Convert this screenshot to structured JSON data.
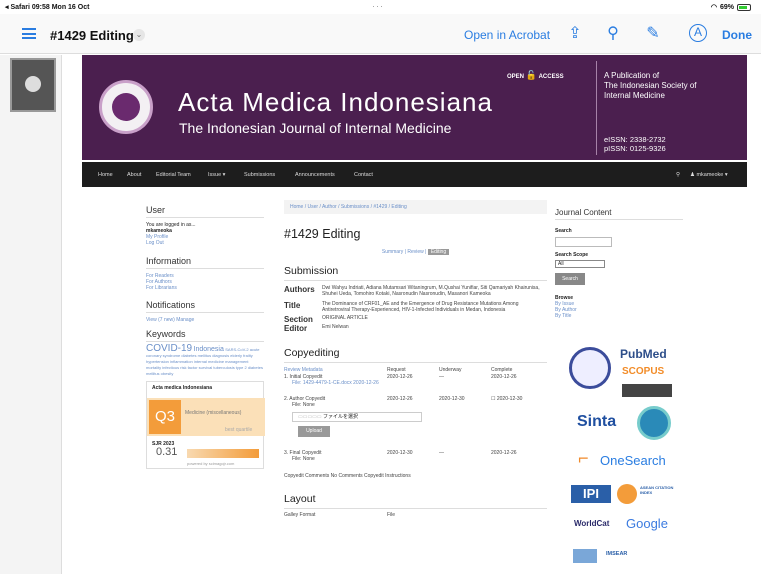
{
  "status": {
    "left": "◂ Safari  09:58  Mon 16 Oct",
    "center": "···",
    "battery": "69%"
  },
  "toolbar": {
    "title": "#1429 Editing",
    "open_acrobat": "Open in Acrobat",
    "done": "Done"
  },
  "banner": {
    "open_access": "OPEN",
    "access": "ACCESS",
    "title": "Acta Medica Indonesiana",
    "subtitle": "The Indonesian Journal of Internal Medicine",
    "pub1": "A Publication of",
    "pub2": "The Indonesian Society of",
    "pub3": "Internal Medicine",
    "eissn": "eISSN: 2338-2732",
    "pissn": "pISSN: 0125-9326"
  },
  "nav": {
    "home": "Home",
    "about": "About",
    "editorial": "Editorial Team",
    "issue": "Issue ▾",
    "submissions": "Submissions",
    "announcements": "Announcements",
    "contact": "Contact",
    "user": "♟ mkameoke ▾"
  },
  "left": {
    "user_h": "User",
    "logged": "You are logged in as...",
    "uname": "mkameoka",
    "profile": "My Profile",
    "logout": "Log Out",
    "info_h": "Information",
    "readers": "For Readers",
    "authors": "For Authors",
    "librarians": "For Librarians",
    "notif_h": "Notifications",
    "view": "View (7 new)",
    "manage": "Manage",
    "kw_h": "Keywords",
    "kw_big": "COVID-19",
    "kw_med": "Indonesia",
    "kw_small": "SARS-CoV-2 acute coronary syndrome diabetes mellitus diagnosis elderly frailty hypertension inflammation internal medicine management mortality infectious risk factor survival tuberculosis type 2 diabetes mellitus obesity",
    "sj_title": "Acta medica Indonesiana",
    "sj_q": "Q3",
    "sj_cat": "Medicine (miscellaneous)",
    "sj_best": "best quartile",
    "sj_label": "SJR 2023",
    "sj_value": "0.31",
    "sj_powered": "powered by scimagojr.com"
  },
  "main": {
    "crumb": "Home  /  User  /  Author  /  Submissions  /  #1429  /  Editing",
    "title": "#1429 Editing",
    "tabs": {
      "summary": "Summary",
      "review": "Review",
      "editing": "Editing"
    },
    "submission_h": "Submission",
    "authors_k": "Authors",
    "authors_v": "Dwi Wahyu Indriati, Adiana Mutamsari Witaningrum, M.Qushai Yunifiar, Siti Qamariyah Khairunisa, Shuhei Ueda, Tomohiro Kotaki, Nasronudin Nasronudin, Masanori Kameoka",
    "title_k": "Title",
    "title_v": "The Dominance of CRF01_AE and the Emergence of Drug Resistance Mutations Among Antiretroviral Therapy-Experienced, HIV-1-Infected Individuals in Medan, Indonesia",
    "section_k": "Section",
    "section_v": "ORIGINAL ARTICLE",
    "editor_k": "Editor",
    "editor_v": "Emi Nelwan",
    "copy_h": "Copyediting",
    "cols": {
      "meta": "Review Metadata",
      "req": "Request",
      "und": "Underway",
      "comp": "Complete"
    },
    "r1": {
      "name": "1.  Initial Copyedit",
      "file": "File: 1429-4479-1-CE.docx  2020-12-26",
      "req": "2020-12-26",
      "und": "—",
      "comp": "2020-12-26"
    },
    "r2": {
      "name": "2.  Author Copyedit",
      "file": "File: None",
      "req": "2020-12-26",
      "und": "2020-12-30",
      "comp": "☐ 2020-12-30"
    },
    "choose": "ファイルを選択",
    "upload": "Upload",
    "r3": {
      "name": "3.  Final Copyedit",
      "file": "File: None",
      "req": "2020-12-30",
      "und": "—",
      "comp": "2020-12-26"
    },
    "copy_comments": "Copyedit Comments   No Comments     Copyedit Instructions",
    "layout_h": "Layout",
    "layout_cols": {
      "a": "Galley Format",
      "b": "File"
    }
  },
  "right": {
    "jc_h": "Journal Content",
    "search_l": "Search",
    "scope_l": "Search Scope",
    "scope_v": "All",
    "search_btn": "Search",
    "browse": "Browse",
    "by_issue": "By Issue",
    "by_author": "By Author",
    "by_title": "By Title"
  },
  "indexers": {
    "pubmed": "PubMed",
    "scopus": "SCOPUS",
    "sinta": "Sinta",
    "onesearch": "OneSearch",
    "ipi": "IPI",
    "asean": "ASEAN CITATION INDEX",
    "worldcat": "WorldCat",
    "google": "Google",
    "imsear": "IMSEAR"
  },
  "colors": {
    "banner": "#4b1f4f",
    "accent": "#2a7de1",
    "sj": "#f39c3a"
  }
}
